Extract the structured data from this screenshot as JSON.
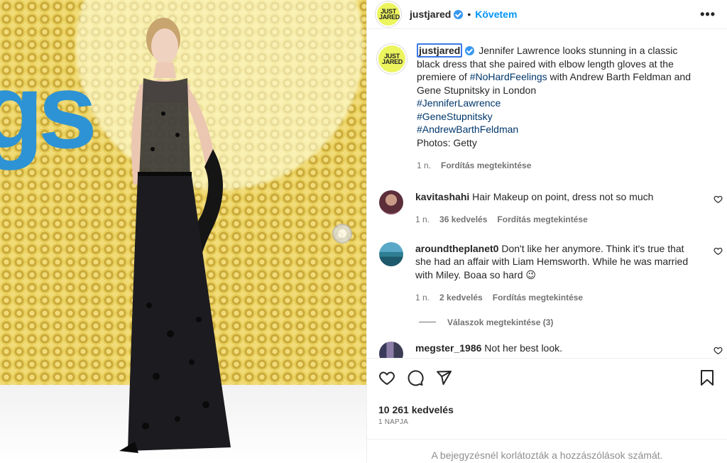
{
  "header": {
    "username": "justjared",
    "separator": "•",
    "follow_label": "Követem",
    "more_label": "•••"
  },
  "brand_logo_text": "JUST JARED",
  "caption": {
    "username": "justjared",
    "text_1": "Jennifer Lawrence looks stunning in a classic black dress that she paired with elbow length gloves at the premiere of ",
    "hashtag_inline": "#NoHardFeelings",
    "text_2": " with Andrew Barth Feldman and Gene Stupnitsky in London",
    "hashtags": [
      "#JenniferLawrence",
      "#GeneStupnitsky",
      "#AndrewBarthFeldman"
    ],
    "photo_credit": "Photos: Getty",
    "time": "1 n.",
    "translate_label": "Fordítás megtekintése"
  },
  "comments": [
    {
      "username": "kavitashahi",
      "text": "Hair Makeup on point, dress not so much",
      "time": "1 n.",
      "likes": "36 kedvelés",
      "translate_label": "Fordítás megtekintése"
    },
    {
      "username": "aroundtheplanet0",
      "text": "Don't like her anymore. Think it's true that she had an affair with Liam Hemsworth. While he was married with Miley. Boaa so hard 😉",
      "time": "1 n.",
      "likes": "2 kedvelés",
      "translate_label": "Fordítás megtekintése",
      "replies_label": "Válaszok megtekintése (3)"
    },
    {
      "username": "megster_1986",
      "text": "Not her best look."
    }
  ],
  "likes_count": "10 261 kedvelés",
  "post_age": "1 NAPJA",
  "footer_note": "A bejegyzésnél korlátozták a hozzászólások számát.",
  "photo_sign_text": "gs",
  "colors": {
    "accent_blue": "#0095f6",
    "hashtag": "#00376b",
    "avatar_yellow": "#ecf45e",
    "muted": "#737373"
  }
}
